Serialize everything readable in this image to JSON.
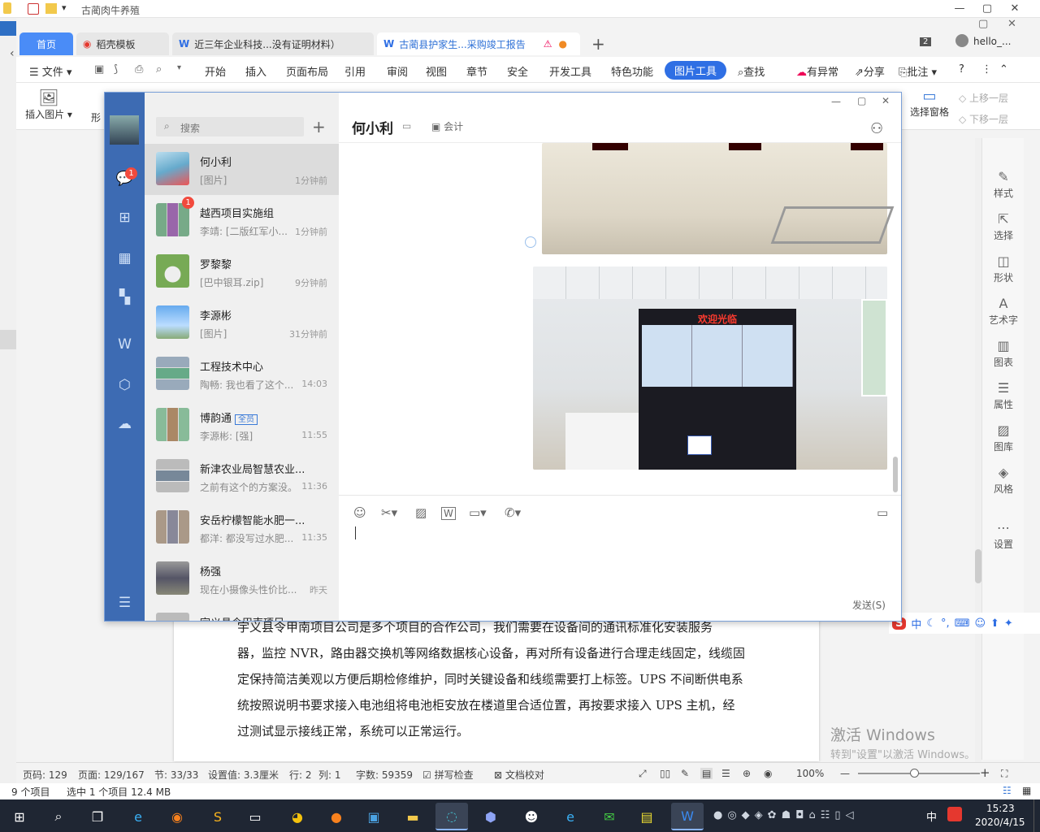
{
  "explorer": {
    "title": "古蔺肉牛养殖",
    "footer_items": "9 个项目",
    "footer_selected": "选中 1 个项目  12.4 MB"
  },
  "wps": {
    "tabs": {
      "home": "首页",
      "t1": "稻壳模板",
      "t2": "近三年企业科技...没有证明材料）",
      "t3": "古蔺县护家生...采购竣工报告"
    },
    "page_count_badge": "2",
    "user": "hello_...",
    "menu": {
      "file": "文件",
      "start": "开始",
      "insert": "插入",
      "layout": "页面布局",
      "ref": "引用",
      "review": "审阅",
      "view": "视图",
      "chapter": "章节",
      "security": "安全",
      "dev": "开发工具",
      "special": "特色功能",
      "picture_tool": "图片工具",
      "find": "查找",
      "exception": "有异常",
      "share": "分享",
      "comment": "批注"
    },
    "ribbon": {
      "insert_pic": "插入图片",
      "shape": "形",
      "select_pane": "选择窗格",
      "up": "上移一层",
      "down": "下移一层"
    },
    "right_panel": [
      {
        "icon": "pen-icon",
        "label": "样式"
      },
      {
        "icon": "cursor-icon",
        "label": "选择"
      },
      {
        "icon": "shape-icon",
        "label": "形状"
      },
      {
        "icon": "art-text-icon",
        "label": "艺术字"
      },
      {
        "icon": "chart-icon",
        "label": "图表"
      },
      {
        "icon": "properties-icon",
        "label": "属性"
      },
      {
        "icon": "gallery-icon",
        "label": "图库"
      },
      {
        "icon": "style-icon",
        "label": "风格"
      },
      {
        "icon": "settings-icon",
        "label": "设置"
      }
    ],
    "doc_lines": [
      "宇义县令甲南项目公司是多个项目的合作公司，我们需要在设备间的通讯标准化安装服务",
      "器，监控 NVR，路由器交换机等网络数据核心设备，再对所有设备进行合理走线固定，线缆固",
      "定保持简洁美观以方便后期检修维护，同时关键设备和线缆需要打上标签。UPS 不间断供电系",
      "统按照说明书要求接入电池组将电池柜安放在楼道里合适位置，再按要求接入 UPS 主机，经",
      "过测试显示接线正常，系统可以正常运行。"
    ],
    "watermark": {
      "title": "激活 Windows",
      "sub": "转到\"设置\"以激活 Windows。"
    },
    "status": {
      "page_code": "页码: 129",
      "page": "页面: 129/167",
      "section": "节: 33/33",
      "setting": "设置值: 3.3厘米",
      "row": "行: 2",
      "col": "列: 1",
      "words": "字数: 59359",
      "spell": "拼写检查",
      "proof": "文档校对",
      "zoom": "100%"
    }
  },
  "chat": {
    "search_placeholder": "搜索",
    "nav_badge": "1",
    "conversations": [
      {
        "name": "何小利",
        "preview": "[图片]",
        "time": "1分钟前",
        "selected": true,
        "badge": ""
      },
      {
        "name": "越西项目实施组",
        "preview": "李靖: [二版红军小...",
        "time": "1分钟前",
        "badge": "1"
      },
      {
        "name": "罗黎黎",
        "preview": "[巴中银耳.zip]",
        "time": "9分钟前",
        "badge": ""
      },
      {
        "name": "李源彬",
        "preview": "[图片]",
        "time": "31分钟前",
        "badge": ""
      },
      {
        "name": "工程技术中心",
        "preview": "陶畅: 我也看了这个...",
        "time": "14:03",
        "badge": ""
      },
      {
        "name": "博韵通",
        "tag": "全员",
        "preview": "李源彬: [强]",
        "time": "11:55",
        "badge": ""
      },
      {
        "name": "新津农业局智慧农业...",
        "preview": "之前有这个的方案没。",
        "time": "11:36",
        "badge": ""
      },
      {
        "name": "安岳柠檬智能水肥一...",
        "preview": "都洋: 都没写过水肥...",
        "time": "11:35",
        "badge": ""
      },
      {
        "name": "杨强",
        "preview": "现在小摄像头性价比...",
        "time": "昨天",
        "badge": ""
      },
      {
        "name": "宇义县令甲南项目",
        "preview": "",
        "time": "",
        "badge": ""
      }
    ],
    "contact_name": "何小利",
    "contact_role": "会计",
    "screen_text": "欢迎光临",
    "send_label": "发送(S)"
  },
  "ime": {
    "lang": "中"
  },
  "taskbar": {
    "time": "15:23",
    "date": "2020/4/15",
    "ime": "中"
  },
  "colors": {
    "accent": "#2f6fe4",
    "chat_nav": "#3d6bb3",
    "badge": "#f24a3d"
  }
}
